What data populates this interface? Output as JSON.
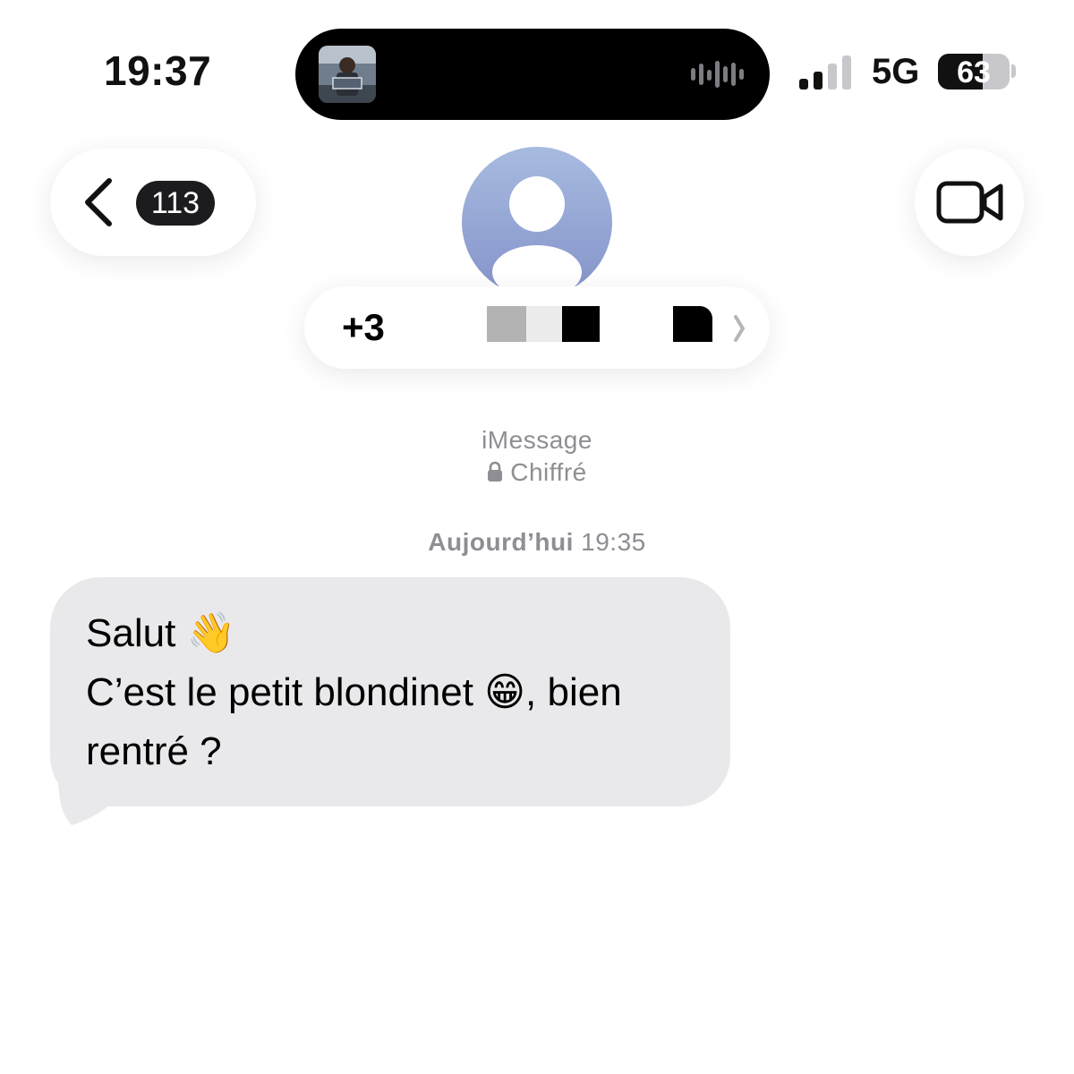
{
  "status_bar": {
    "time": "19:37",
    "network": "5G",
    "battery_percent": "63",
    "battery_level": 0.63,
    "signal_bars_active": 2,
    "signal_bars_total": 4
  },
  "header": {
    "back_badge": "113",
    "contact_number_visible": "+3"
  },
  "conversation": {
    "service": "iMessage",
    "encryption": "Chiffré",
    "timestamp_day": "Aujourd’hui",
    "timestamp_time": "19:35"
  },
  "message": {
    "line1": "Salut 👋",
    "line2": "C’est le petit blondinet 😁, bien",
    "line3": "rentré ?"
  },
  "colors": {
    "bubble": "#e9e9eb",
    "meta_text": "#8e8e93",
    "avatar_top": "#a7bbe0",
    "avatar_bottom": "#8493c9"
  },
  "icons": [
    "back-chevron-icon",
    "video-camera-icon",
    "lock-icon",
    "signal-icon",
    "battery-icon",
    "audio-wave-icon",
    "contact-avatar-icon"
  ]
}
